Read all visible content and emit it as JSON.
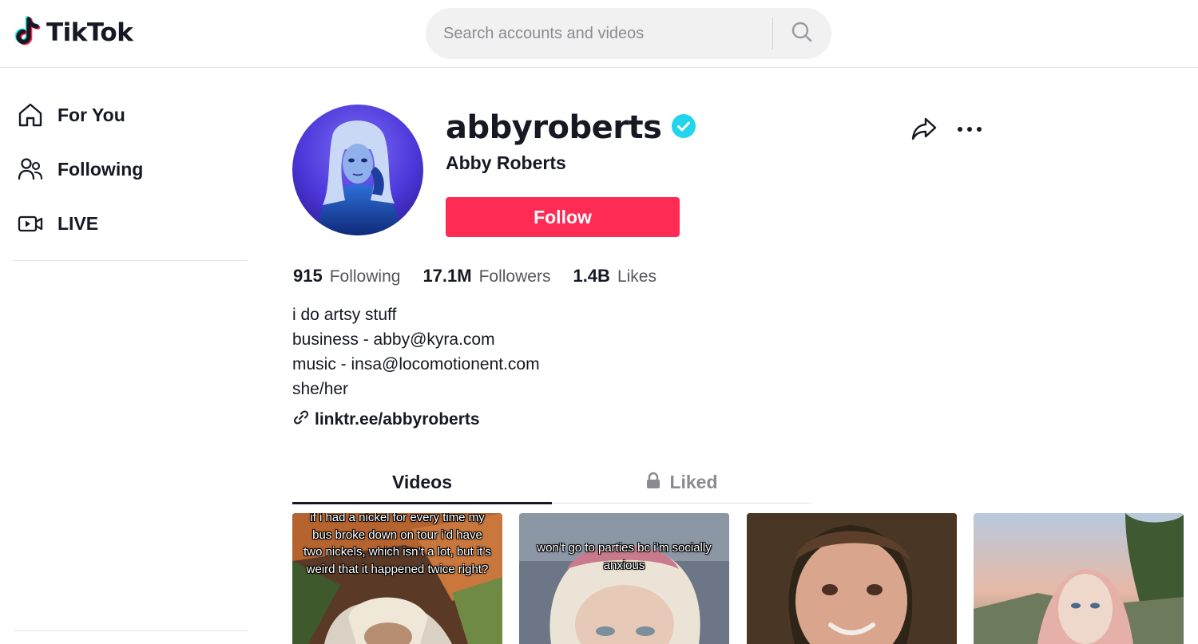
{
  "header": {
    "logo_text": "TikTok",
    "search_placeholder": "Search accounts and videos"
  },
  "sidebar": {
    "items": [
      {
        "label": "For You",
        "icon": "home-icon"
      },
      {
        "label": "Following",
        "icon": "people-icon"
      },
      {
        "label": "LIVE",
        "icon": "live-camera-icon"
      }
    ]
  },
  "profile": {
    "username": "abbyroberts",
    "verified": true,
    "display_name": "Abby Roberts",
    "follow_label": "Follow",
    "stats": [
      {
        "value": "915",
        "label": "Following"
      },
      {
        "value": "17.1M",
        "label": "Followers"
      },
      {
        "value": "1.4B",
        "label": "Likes"
      }
    ],
    "bio": [
      "i do artsy stuff",
      "business - abby@kyra.com",
      "music - insa@locomotionent.com",
      "she/her"
    ],
    "link": "linktr.ee/abbyroberts"
  },
  "tabs": [
    {
      "label": "Videos",
      "active": true
    },
    {
      "label": "Liked",
      "active": false,
      "locked": true
    }
  ],
  "videos": [
    {
      "caption": "if i had a nickel for every time my bus broke down on tour i’d have two nickels, which isn’t a lot, but it’s weird that it happened twice right?"
    },
    {
      "caption": "won’t go to parties bc i’m socially anxious"
    },
    {
      "caption": ""
    },
    {
      "caption": ""
    }
  ],
  "colors": {
    "accent": "#fe2c55",
    "verified": "#20d5ec",
    "text": "#161823",
    "muted": "#55565c"
  }
}
